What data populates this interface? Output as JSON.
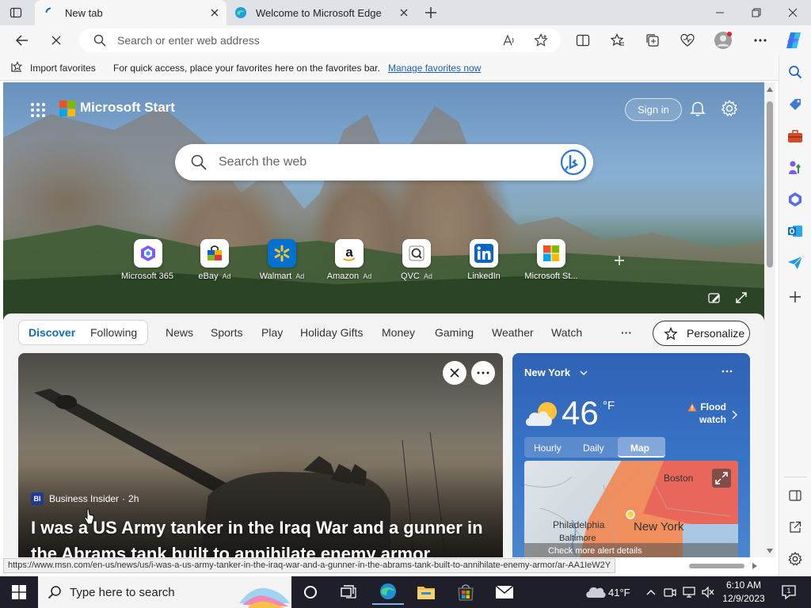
{
  "tabs": [
    {
      "title": "New tab",
      "active": true
    },
    {
      "title": "Welcome to Microsoft Edge",
      "active": false
    }
  ],
  "address_bar": {
    "placeholder": "Search or enter web address"
  },
  "favorites_bar": {
    "import_label": "Import favorites",
    "message": "For quick access, place your favorites here on the favorites bar.",
    "manage_link": "Manage favorites now"
  },
  "page": {
    "brand": "Microsoft Start",
    "sign_in": "Sign in",
    "search_placeholder": "Search the web",
    "quick_links": [
      {
        "label": "Microsoft 365",
        "ad": "",
        "icon": "microsoft-365-icon"
      },
      {
        "label": "eBay",
        "ad": "Ad",
        "icon": "ebay-icon"
      },
      {
        "label": "Walmart",
        "ad": "Ad",
        "icon": "walmart-icon"
      },
      {
        "label": "Amazon",
        "ad": "Ad",
        "icon": "amazon-icon"
      },
      {
        "label": "QVC",
        "ad": "Ad",
        "icon": "qvc-icon"
      },
      {
        "label": "LinkedIn",
        "ad": "",
        "icon": "linkedin-icon"
      },
      {
        "label": "Microsoft St...",
        "ad": "",
        "icon": "microsoft-store-icon"
      }
    ],
    "feed_nav": {
      "items": [
        "Discover",
        "Following",
        "News",
        "Sports",
        "Play",
        "Holiday Gifts",
        "Money",
        "Gaming",
        "Weather",
        "Watch"
      ],
      "more": "···",
      "personalize": "Personalize"
    },
    "news_card": {
      "source": "Business Insider",
      "source_badge": "BI",
      "age": "2h",
      "headline": "I was a US Army tanker in the Iraq War and a gunner in the Abrams tank built to annihilate enemy armor"
    },
    "weather_card": {
      "city": "New York",
      "temperature": "46",
      "unit": "°F",
      "alert": "Flood watch",
      "tabs": [
        "Hourly",
        "Daily",
        "Map"
      ],
      "selected_tab": "Map",
      "map_labels": [
        "Boston",
        "Philadelphia",
        "New York",
        "Baltimore"
      ],
      "map_footer": "Check more alert details"
    }
  },
  "status_url": "https://www.msn.com/en-us/news/us/i-was-a-us-army-tanker-in-the-iraq-war-and-a-gunner-in-the-abrams-tank-built-to-annihilate-enemy-armor/ar-AA1IeW2Y",
  "taskbar": {
    "search_placeholder": "Type here to search",
    "weather_temp": "41°F",
    "time": "6:10 AM",
    "date": "12/9/2023",
    "notification_count": "1"
  }
}
